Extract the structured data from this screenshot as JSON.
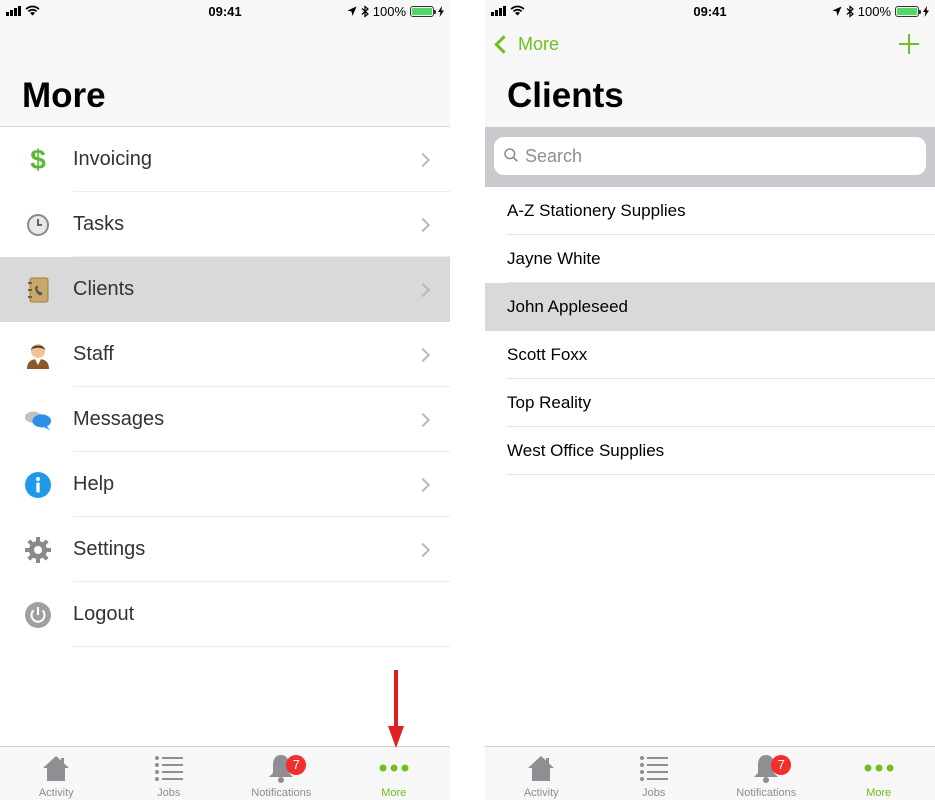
{
  "status_bar": {
    "time": "09:41",
    "battery": "100%"
  },
  "left_screen": {
    "title": "More",
    "menu_items": [
      {
        "label": "Invoicing",
        "icon": "dollar-icon",
        "chevron": true,
        "selected": false
      },
      {
        "label": "Tasks",
        "icon": "clock-icon",
        "chevron": true,
        "selected": false
      },
      {
        "label": "Clients",
        "icon": "address-book-icon",
        "chevron": true,
        "selected": true
      },
      {
        "label": "Staff",
        "icon": "person-icon",
        "chevron": true,
        "selected": false
      },
      {
        "label": "Messages",
        "icon": "chat-bubbles-icon",
        "chevron": true,
        "selected": false
      },
      {
        "label": "Help",
        "icon": "info-icon",
        "chevron": true,
        "selected": false
      },
      {
        "label": "Settings",
        "icon": "gear-icon",
        "chevron": true,
        "selected": false
      },
      {
        "label": "Logout",
        "icon": "power-icon",
        "chevron": false,
        "selected": false
      }
    ]
  },
  "right_screen": {
    "back_label": "More",
    "title": "Clients",
    "search": {
      "placeholder": "Search",
      "value": ""
    },
    "clients": [
      {
        "name": "A-Z Stationery Supplies",
        "selected": false
      },
      {
        "name": "Jayne White",
        "selected": false
      },
      {
        "name": "John Appleseed",
        "selected": true
      },
      {
        "name": "Scott Foxx",
        "selected": false
      },
      {
        "name": "Top Reality",
        "selected": false
      },
      {
        "name": "West Office Supplies",
        "selected": false
      }
    ]
  },
  "tab_bar": {
    "tabs": [
      {
        "label": "Activity",
        "icon": "house-icon",
        "active": false
      },
      {
        "label": "Jobs",
        "icon": "list-icon",
        "active": false
      },
      {
        "label": "Notifications",
        "icon": "bell-icon",
        "active": false,
        "badge": "7"
      },
      {
        "label": "More",
        "icon": "more-dots-icon",
        "active": true
      }
    ]
  },
  "colors": {
    "accent": "#6fbf1e",
    "badge": "#f32e2e",
    "selected_row": "#d9d9d9",
    "arrow": "#e02020"
  },
  "annotation": {
    "arrow": "red-down-arrow"
  }
}
